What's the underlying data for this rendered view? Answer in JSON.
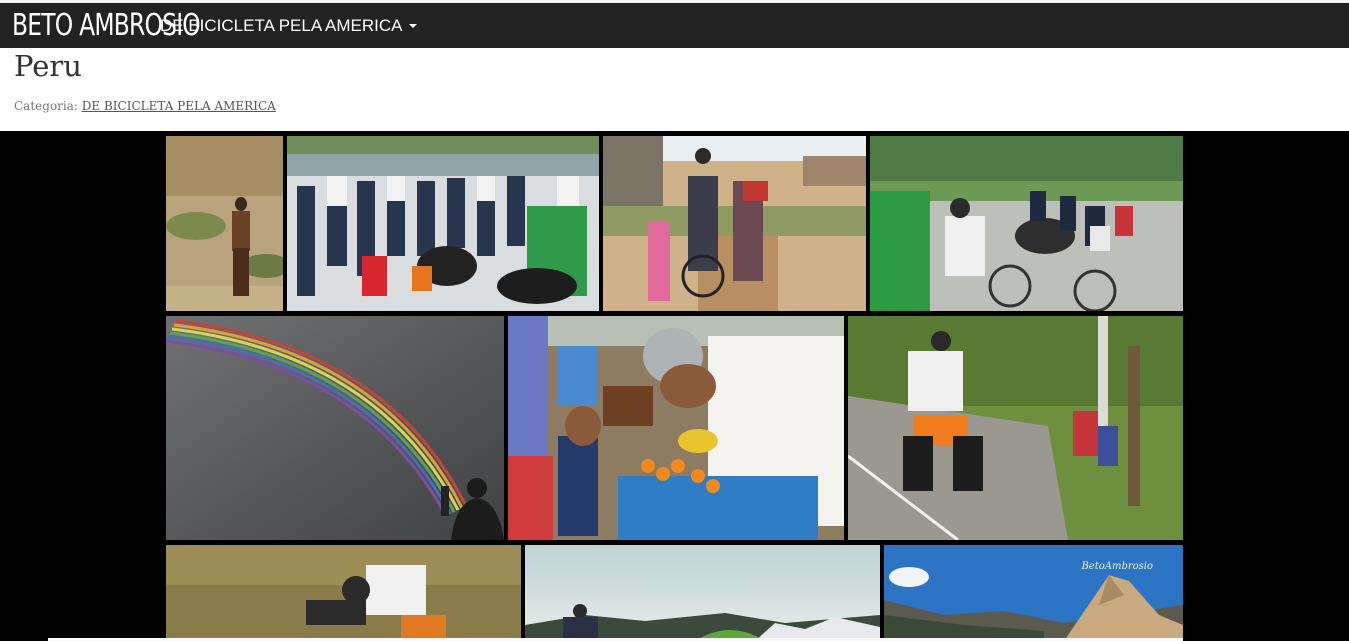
{
  "navbar": {
    "brand": "BETO AMBROSIO",
    "menu_label": "DE BICICLETA PELA AMERICA"
  },
  "page": {
    "title": "Peru",
    "category_prefix": "Categoria:",
    "category_link": "DE BICICLETA PELA AMERICA"
  },
  "gallery": {
    "photos": [
      {
        "subject": "hiker on dry hillside"
      },
      {
        "subject": "crowd of people with bicycle"
      },
      {
        "subject": "cyclist with children on dirt road"
      },
      {
        "subject": "cyclist with children in park"
      },
      {
        "subject": "rainbow and cyclist"
      },
      {
        "subject": "cyclist at fruit stand"
      },
      {
        "subject": "loaded bicycle on road with kids"
      },
      {
        "subject": "cyclist on grassy slope"
      },
      {
        "subject": "cyclist by green tent in mountains"
      },
      {
        "subject": "rocky mountain under blue sky"
      }
    ],
    "watermark": "BetoAmbrosio"
  }
}
